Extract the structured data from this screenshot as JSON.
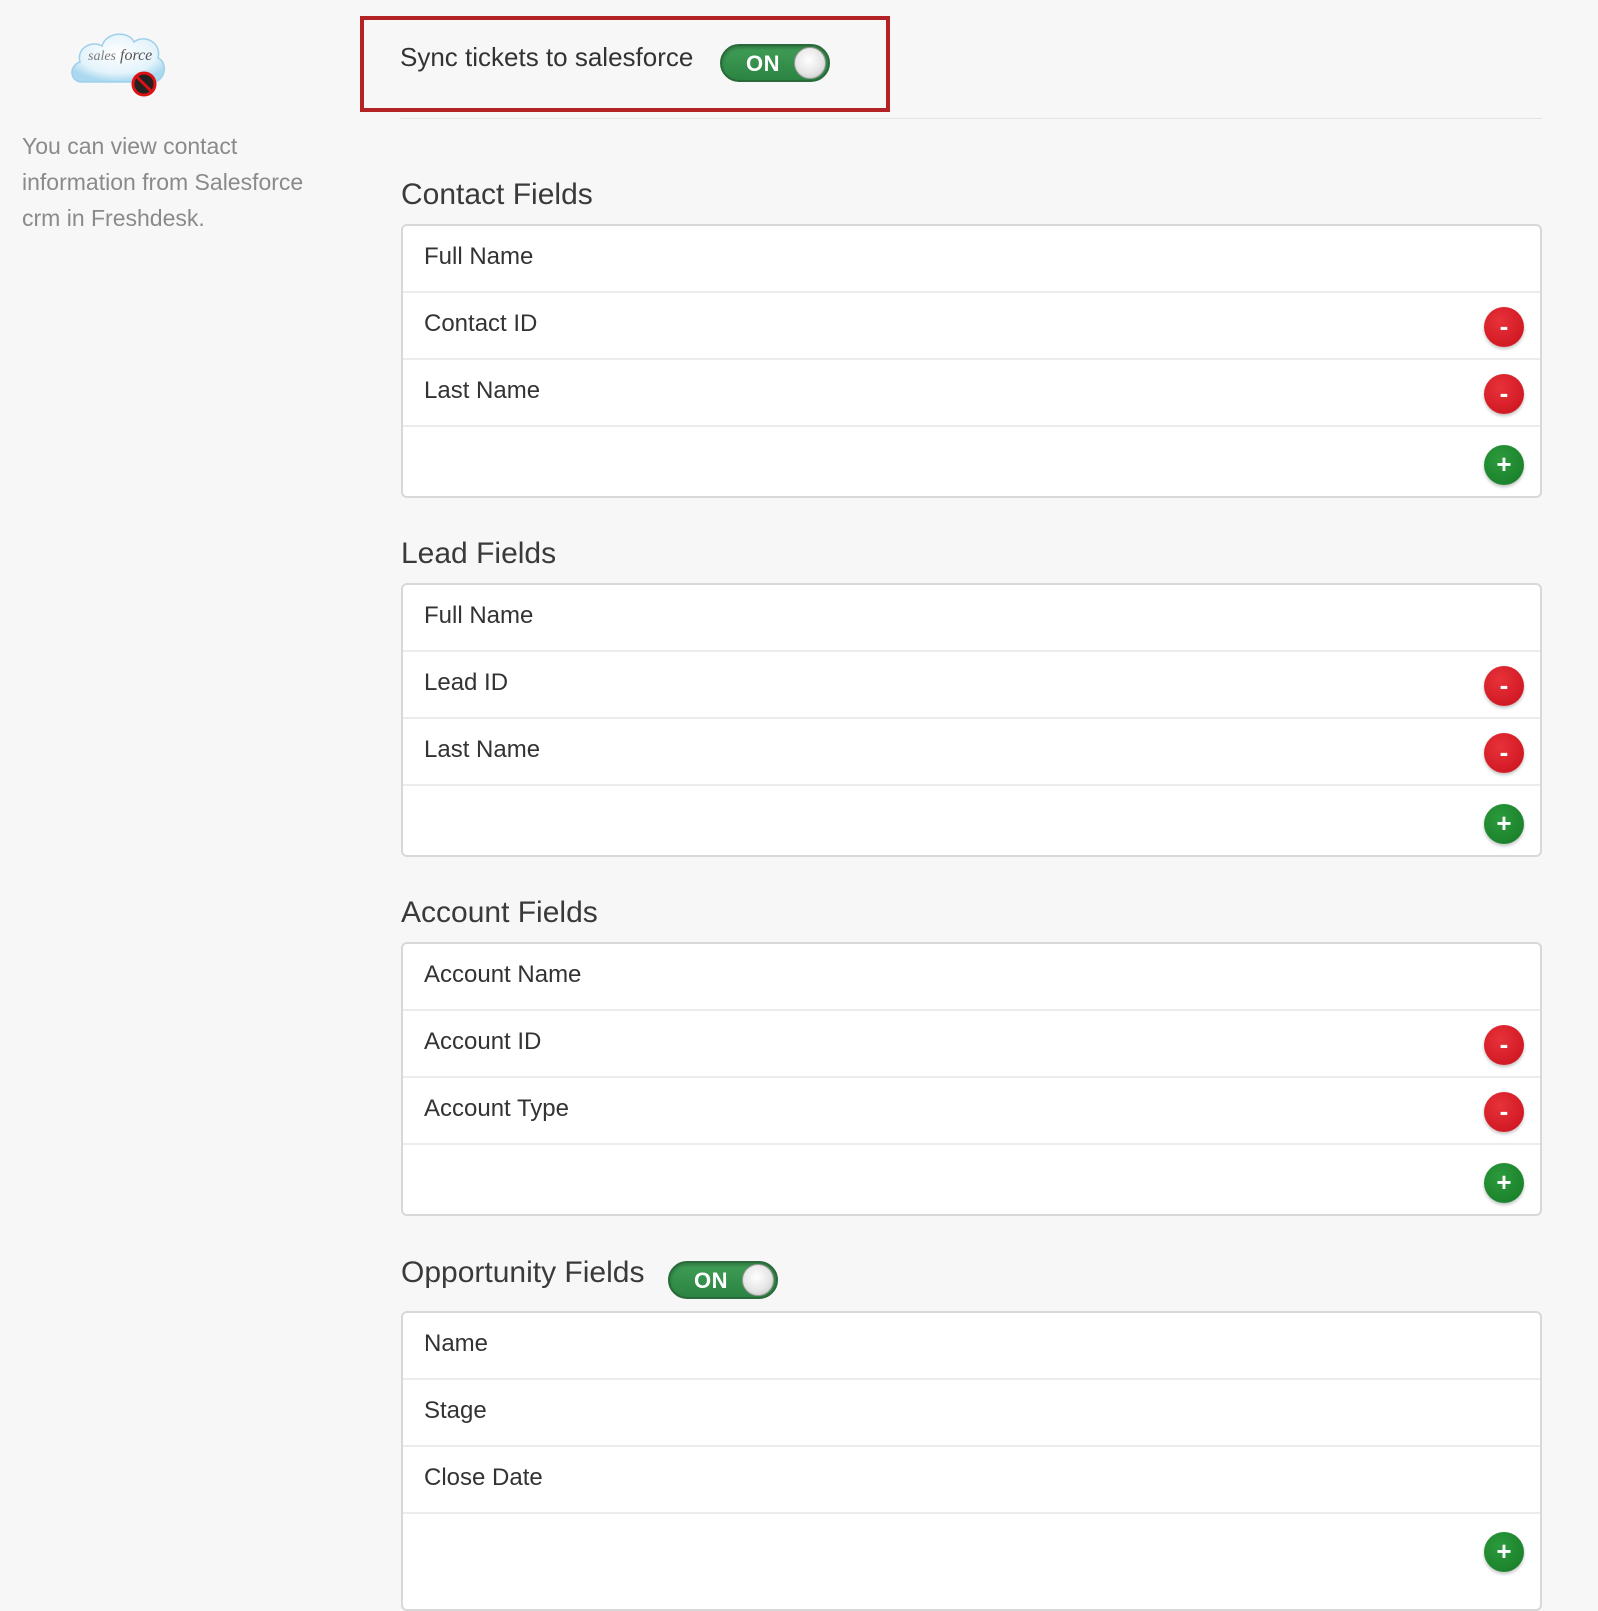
{
  "sidebar": {
    "logo_alt": "salesforce",
    "description": "You can view contact information from Salesforce crm in Freshdesk."
  },
  "sync": {
    "label": "Sync tickets to salesforce",
    "toggle_state": "ON"
  },
  "buttons": {
    "remove_symbol": "-",
    "add_symbol": "+"
  },
  "sections": [
    {
      "title": "Contact Fields",
      "fields": [
        "Full Name",
        "Contact ID",
        "Last Name"
      ],
      "removable": [
        false,
        true,
        true
      ]
    },
    {
      "title": "Lead Fields",
      "fields": [
        "Full Name",
        "Lead ID",
        "Last Name"
      ],
      "removable": [
        false,
        true,
        true
      ]
    },
    {
      "title": "Account Fields",
      "fields": [
        "Account Name",
        "Account ID",
        "Account Type"
      ],
      "removable": [
        false,
        true,
        true
      ]
    },
    {
      "title": "Opportunity Fields",
      "toggle_state": "ON",
      "fields": [
        "Name",
        "Stage",
        "Close Date"
      ],
      "removable": [
        false,
        false,
        false
      ]
    }
  ],
  "colors": {
    "highlight_border": "#b32225",
    "toggle_on": "#3a9550",
    "remove": "#d0141c",
    "add": "#1a8a2c"
  }
}
